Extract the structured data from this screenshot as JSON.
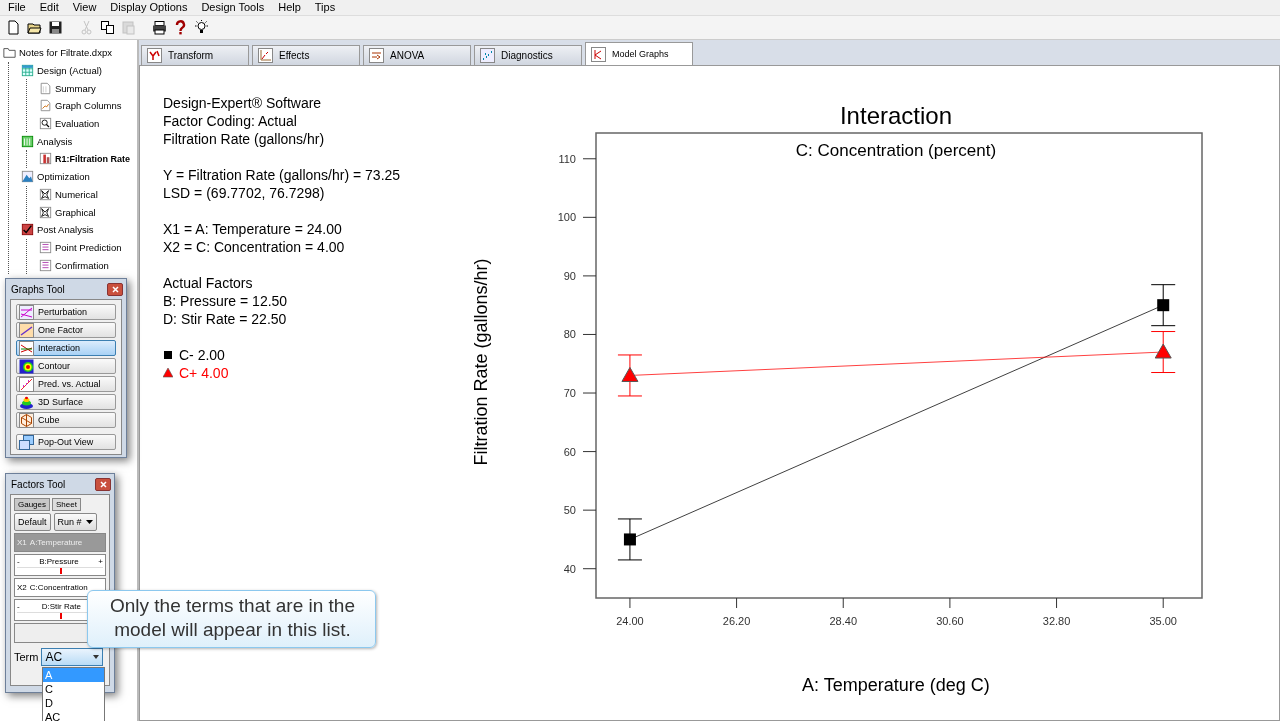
{
  "menu": [
    "File",
    "Edit",
    "View",
    "Display Options",
    "Design Tools",
    "Help",
    "Tips"
  ],
  "toolbar": [
    {
      "kind": "new",
      "disabled": false
    },
    {
      "kind": "open",
      "disabled": false
    },
    {
      "kind": "save",
      "disabled": false
    },
    {
      "kind": "cut",
      "disabled": true
    },
    {
      "kind": "copy",
      "disabled": false
    },
    {
      "kind": "paste",
      "disabled": true
    },
    {
      "kind": "print",
      "disabled": false
    },
    {
      "kind": "help",
      "disabled": false
    },
    {
      "kind": "tip",
      "disabled": false
    }
  ],
  "tree": {
    "label": "Notes for Filtrate.dxpx",
    "kind": "folder",
    "selected": false,
    "children": [
      {
        "label": "Design (Actual)",
        "kind": "grid",
        "selected": false,
        "children": [
          {
            "label": "Summary",
            "kind": "page",
            "selected": false
          },
          {
            "label": "Graph Columns",
            "kind": "graph",
            "selected": false
          },
          {
            "label": "Evaluation",
            "kind": "magnifier",
            "selected": false
          }
        ]
      },
      {
        "label": "Analysis",
        "kind": "bars",
        "selected": false,
        "children": [
          {
            "label": "R1:Filtration Rate",
            "kind": "response",
            "selected": true
          }
        ]
      },
      {
        "label": "Optimization",
        "kind": "mountain",
        "selected": false,
        "children": [
          {
            "label": "Numerical",
            "kind": "star",
            "selected": false
          },
          {
            "label": "Graphical",
            "kind": "star",
            "selected": false
          }
        ]
      },
      {
        "label": "Post Analysis",
        "kind": "check",
        "selected": false,
        "children": [
          {
            "label": "Point Prediction",
            "kind": "table",
            "selected": false
          },
          {
            "label": "Confirmation",
            "kind": "table",
            "selected": false
          }
        ]
      }
    ]
  },
  "tabs": [
    {
      "label": "Transform",
      "kind": "transform",
      "selected": false
    },
    {
      "label": "Effects",
      "kind": "effects",
      "selected": false
    },
    {
      "label": "ANOVA",
      "kind": "anova",
      "selected": false
    },
    {
      "label": "Diagnostics",
      "kind": "diagnostics",
      "selected": false
    },
    {
      "label": "Model Graphs",
      "kind": "graphs",
      "selected": true
    }
  ],
  "info": [
    [
      "Design-Expert® Software",
      "Factor Coding: Actual",
      "Filtration Rate (gallons/hr)"
    ],
    [
      "Y = Filtration Rate (gallons/hr) = 73.25",
      "LSD = (69.7702, 76.7298)"
    ],
    [
      "X1 = A: Temperature = 24.00",
      "X2 = C: Concentration = 4.00"
    ],
    [
      "Actual Factors",
      "B: Pressure = 12.50",
      "D: Stir Rate = 22.50"
    ]
  ],
  "chart_data": {
    "type": "line",
    "title": "Interaction",
    "subtitle": "C: Concentration (percent)",
    "xlabel": "A: Temperature (deg C)",
    "ylabel": "Filtration Rate (gallons/hr)",
    "x": [
      24,
      35
    ],
    "series": [
      {
        "name": "C- 2.00",
        "color": "#000000",
        "marker": "square",
        "values": [
          45,
          85
        ],
        "errors": [
          3.5,
          3.5
        ]
      },
      {
        "name": "C+ 4.00",
        "color": "#ff0000",
        "marker": "triangle",
        "values": [
          73,
          77
        ],
        "errors": [
          3.5,
          3.5
        ]
      }
    ],
    "xlim": [
      23.3,
      35.8
    ],
    "ylim": [
      35,
      114.4
    ],
    "xticks": [
      {
        "value": 24,
        "label": "24.00"
      },
      {
        "value": 26.2,
        "label": "26.20"
      },
      {
        "value": 28.4,
        "label": "28.40"
      },
      {
        "value": 30.6,
        "label": "30.60"
      },
      {
        "value": 32.8,
        "label": "32.80"
      },
      {
        "value": 35,
        "label": "35.00"
      }
    ],
    "yticks": [
      40,
      50,
      60,
      70,
      80,
      90,
      100,
      110
    ]
  },
  "graphs_tool": {
    "title": "Graphs Tool",
    "buttons": [
      {
        "label": "Perturbation",
        "kind": "perturbation",
        "selected": false
      },
      {
        "label": "One Factor",
        "kind": "onefactor",
        "selected": false
      },
      {
        "label": "Interaction",
        "kind": "interaction",
        "selected": true
      },
      {
        "label": "Contour",
        "kind": "contour",
        "selected": false
      },
      {
        "label": "Pred. vs. Actual",
        "kind": "predicted",
        "selected": false
      },
      {
        "label": "3D Surface",
        "kind": "surface",
        "selected": false
      },
      {
        "label": "Cube",
        "kind": "cube",
        "selected": false
      }
    ],
    "popout_button": {
      "label": "Pop-Out View",
      "kind": "popout"
    }
  },
  "factors_tool": {
    "title": "Factors Tool",
    "tabs": [
      {
        "label": "Gauges",
        "selected": true
      },
      {
        "label": "Sheet",
        "selected": false
      }
    ],
    "default_button": "Default",
    "run_select": "Run #",
    "factors": [
      {
        "kind": "axis",
        "axis": "X1",
        "name": "A:Temperature",
        "selected": true
      },
      {
        "kind": "gauge",
        "name": "B:Pressure",
        "minus": "-",
        "plus": "+",
        "level": 0.5
      },
      {
        "kind": "axis",
        "axis": "X2",
        "name": "C:Concentration",
        "selected": false
      },
      {
        "kind": "gauge",
        "name": "D:Stir Rate",
        "minus": "-",
        "level": 0.5
      }
    ],
    "term_label": "Term",
    "term_value": "AC",
    "term_options": [
      {
        "label": "A",
        "selected": true
      },
      {
        "label": "C",
        "selected": false
      },
      {
        "label": "D",
        "selected": false
      },
      {
        "label": "AC",
        "selected": false
      }
    ]
  },
  "callout": {
    "text": "Only the terms that are in the model will appear in this list."
  }
}
